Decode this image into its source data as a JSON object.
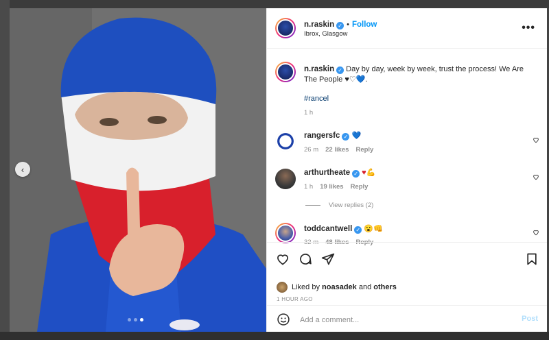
{
  "post": {
    "author": "n.raskin",
    "follow_label": "Follow",
    "separator": "•",
    "location": "Ibrox, Glasgow",
    "more_label": "•••"
  },
  "caption": {
    "username": "n.raskin",
    "text": "Day by day, week by week, trust the process! We Are The People ♥♡💙.",
    "hashtag": "#rancel",
    "time": "1 h"
  },
  "comments": [
    {
      "username": "rangersfc",
      "text": "💙",
      "time": "26 m",
      "likes": "22 likes",
      "reply": "Reply"
    },
    {
      "username": "arthurtheate",
      "text": "♥💪",
      "time": "1 h",
      "likes": "19 likes",
      "reply": "Reply"
    },
    {
      "username": "toddcantwell",
      "text": "😮👊",
      "time": "32 m",
      "likes": "48 likes",
      "reply": "Reply"
    }
  ],
  "view_replies": "View replies (2)",
  "likes": {
    "prefix": "Liked by",
    "user": "noasadek",
    "conj": "and",
    "others": "others"
  },
  "time_ago": "1 HOUR AGO",
  "comment_box": {
    "placeholder": "Add a comment...",
    "post_label": "Post"
  },
  "colors": {
    "accent": "#0095f6",
    "verified": "#3897f0",
    "rangers_blue": "#1b3fa8",
    "rangers_red": "#d8202c"
  }
}
